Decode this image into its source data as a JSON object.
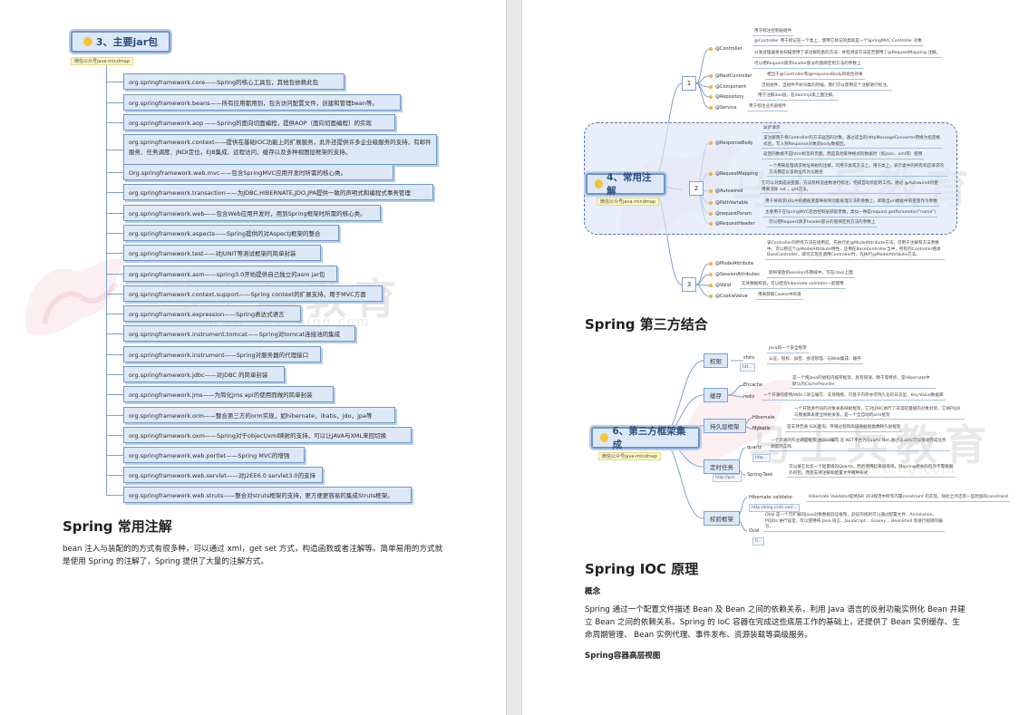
{
  "left": {
    "mindmap": {
      "root": "3、主要jar包",
      "root_tag": "微信公众号java-mindmap",
      "items": [
        "org.springframework.core——Spring的核心工具包，其他包依赖此包",
        "org.springframework.beans——所有应用都用到，包含访问配置文件，创建和管理bean等。",
        "org.springframework.aop ——Spring的面向切面编程，提供AOP（面向切面编程）的实现",
        "org.springframework.context——提供在基础IOC功能上的扩展服务，此外还提供许多企业级服务的支持，有邮件服务、任务调度、JNDI定位，EJB集成、远程访问、缓存以及多种视图层框架的支持。",
        "Org.springframework.web.mvc——包含SpringMVC应用开发时所需的核心类。",
        "org.springframework.transaction——为JDBC,HIBERNATE,JDO,JPA提供一致的声明式和编程式事务管理",
        "org.springframework.web——包含Web应用开发时，用到Spring框架时所需的核心类。",
        "org.springframework.aspects——Spring提供的对AspectJ框架的整合",
        "org.springframework.test——对JUNIT等测试框架的简单封装",
        "org.springframework.asm——spring3.0开始提供自己独立的asm jar包",
        "org.springframework.context.support——Spring context的扩展支持，用于MVC方面",
        "org.springframework.expression——Spring表达式语言",
        "org.springframework.instrument.tomcat——Spring对tomcat连接池的集成",
        "org.springframework.instrument——Spring对服务器的代理接口",
        "org.springframework.jdbc——对JDBC 的简单封装",
        "org.springframework.jms——为简化jms api的使用而做的简单封装",
        "org.springframework.orm——整合第三方的orm实现，如hibernate，ibatis，jdo，jpa等",
        "org.springframework.oxm——Spring对于object/xml映射的支持，可以让JAVA与XML来回切换",
        "org.springframework.web.portlet——Spring MVC的增强",
        "org.springframework.web.servlet——对J2EE6.0 servlet3.0的支持",
        "org.springframework.web.struts——整合对struts框架的支持，更方便更容易的集成Struts框架。"
      ]
    },
    "section_title": "Spring 常用注解",
    "section_body": "bean 注入与装配的的方式有很多种，可以通过 xml，get set 方式，构造函数或者注解等。简单易用的方式就是使用 Spring 的注解了，Spring 提供了大量的注解方式。"
  },
  "right": {
    "annotations_map": {
      "root": "4、常用注解",
      "root_tag": "微信公众号java-mindmap",
      "groups": [
        {
          "number": "1",
          "items": [
            {
              "name": "@Controller",
              "notes": [
                "用于标注控制层组件",
                "@Controller 用于标记在一个类上，使用它标记的类就是一个SpringMVC Controller 对象",
                "分发处理器将会扫描使用了该注解的类的方法，并检测该方法是否使用了@RequestMapping 注解。",
                "可以把Request请求header部分的值绑定到方法的参数上"
              ]
            },
            {
              "name": "@RestController",
              "notes": [
                "相当于@Controller和@responseBody的组合效果"
              ]
            },
            {
              "name": "@Component",
              "notes": [
                "泛指组件，当组件不好归类的时候，我们可以使用这个注解进行标注。"
              ]
            },
            {
              "name": "@Repository",
              "notes": [
                "用于注解dao层，在daoImpl类上面注解。"
              ]
            },
            {
              "name": "@Service",
              "notes": [
                "用于标注业务层组件"
              ]
            }
          ]
        },
        {
          "number": "2",
          "items": [
            {
              "name": "@ResponseBody",
              "notes": [
                "异步请求",
                "该注解用于将Controller的方法返回的对象，通过适当的HttpMessageConverter转换为指定格式后，写入到Response对象的body数据区。",
                "返回的数据不是html标签的页面，而是其他某种格式的数据时（如json、xml等）使用"
              ]
            },
            {
              "name": "@RequestMapping",
              "notes": [
                "一个用来处理请求地址映射的注解，可用于类或方法上。用于类上，表示类中的所有响应请求的方法都是以该地址作为父路径"
              ]
            },
            {
              "name": "@Autowired",
              "notes": [
                "它可以对类成员变量、方法及构造函数进行标注，完成自动装配的工作。通过 @Autowired的使用来消除 set ，get方法。"
              ]
            },
            {
              "name": "@PathVariable",
              "notes": [
                "用于将请求URL中的模板变量映射到功能处理方法的参数上，即取出uri模板中的变量作为参数"
              ]
            },
            {
              "name": "@requestParam",
              "notes": [
                "主要用于在SpringMVC后台控制层获取参数，类似一种是request.getParameter(\"name\")"
              ]
            },
            {
              "name": "@RequestHeader",
              "notes": [
                "可以把Request请求header部分的值绑定到方法的参数上"
              ]
            }
          ]
        },
        {
          "number": "3",
          "items": [
            {
              "name": "@ModelAttribute",
              "notes": [
                "该Controller的所有方法在调用前，先执行此@ModelAttribute方法，可用于注解和方法参数中，可以把这个@ModelAttribute特性，应用在BaseController当中，所有的Controller继承BaseController，即可实现在调用Controller时，先执行@ModelAttribute方法。"
              ]
            },
            {
              "name": "@SessionAttributes",
              "notes": [
                "即将值放到session作用域中，写在class上面"
              ]
            },
            {
              "name": "@Valid",
              "notes": [
                "实体数据校验，可以结合hibernate validator一起使用"
              ]
            },
            {
              "name": "@CookieValue",
              "notes": [
                "用来获取Cookie中的值"
              ]
            }
          ]
        }
      ]
    },
    "third_party_title": "Spring 第三方结合",
    "frameworks_map": {
      "root": "6、第三方框架集成",
      "root_tag": "微信公众号java-mindmap",
      "categories": [
        {
          "name": "权限",
          "items": [
            {
              "name": "shiro",
              "notes": [
                "java的一个安全框架",
                "认证、授权、加密、会话管理、与Web集成、缓存"
              ],
              "link": "htt..."
            }
          ]
        },
        {
          "name": "缓存",
          "items": [
            {
              "name": "Ehcache",
              "notes": [
                "是一个纯Java的进程内缓存框架，具有快速、精干等特点，是Hibernate中默认的CacheProvider"
              ]
            },
            {
              "name": "redis",
              "notes": [
                "一个开源的使用ANSI C语言编写、支持网络、可基于内存亦可持久化的日志型、Key-Value数据库"
              ]
            }
          ]
        },
        {
          "name": "持久层框架",
          "items": [
            {
              "name": "Hibernate",
              "notes": [
                "一个开放源代码的对象关系映射框架，它对JDBC进行了非常轻量级的对象封装，它将POJO与数据库表建立映射关系，是一个全自动的orm框架"
              ]
            },
            {
              "name": "Mybatis",
              "notes": [
                "是支持普通 SQL查询，存储过程和高级映射的优秀持久层框架"
              ]
            }
          ]
        },
        {
          "name": "定时任务",
          "items": [
            {
              "name": "quartz",
              "notes": [
                "一个开源的作业调度框架,由java编写,在.NET平台为Quartz.Net,通过Quartz可以快速完成任务调度的工作."
              ],
              "link": "http..."
            },
            {
              "name": "Spring-Task",
              "notes": [
                "可以将它比作一个轻量级的Quartz，而且使用起来很简单，除spring相关的包外不需要额外的包，而且支持注解和配置文件两种形式"
              ],
              "link": "http://gcs..."
            }
          ]
        },
        {
          "name": "校验框架",
          "items": [
            {
              "name": "Hibernate validator",
              "notes": [
                "Hibernate Validator提供JSR 303规范中所有内置constraint 的实现，除此之外还有一些附加的constraint"
              ],
              "link": "http://blog.csdn.net/..."
            },
            {
              "name": "Oval",
              "notes": [
                "OVal 是一个可扩展的Java对象数据验证框架，验证的规则可以通过配置文件、Annotation、POJOs 进行设定。可以使用纯 Java 语言、JavaScript 、Groovy 、BeanShell 等进行规则的编写。"
              ],
              "link": "h..."
            }
          ]
        }
      ]
    },
    "ioc_title": "Spring IOC 原理",
    "ioc_concept_label": "概念",
    "ioc_body": "Spring 通过一个配置文件描述 Bean 及 Bean 之间的依赖关系，利用 Java 语言的反射功能实例化 Bean 并建立 Bean 之间的依赖关系。Spring 的 IoC 容器在完成这些底层工作的基础上，还提供了 Bean 实例缓存、生命周期管理、 Bean 实例代理、事件发布、资源装载等高级服务。",
    "ioc_view_label": "Spring容器高层视图"
  },
  "watermark": {
    "brand": "马士兵教育",
    "url": "www.mashibing.com"
  }
}
